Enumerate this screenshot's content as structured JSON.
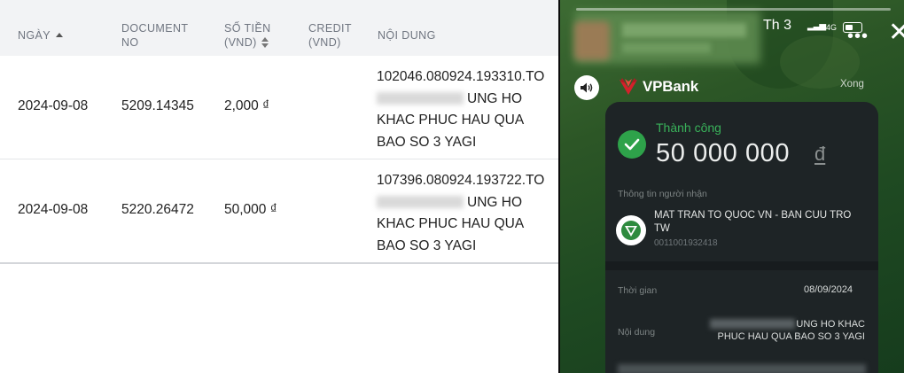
{
  "statement": {
    "headers": {
      "date": "NGÀY",
      "doc_line1": "DOCUMENT",
      "doc_line2": "NO",
      "amount_line1": "SỐ TIỀN",
      "amount_line2": "(VND)",
      "credit_line1": "CREDIT",
      "credit_line2": "(VND)",
      "content": "NỘI DUNG"
    },
    "rows": [
      {
        "date": "2024-09-08",
        "doc_no": "5209.14345",
        "amount": "2,000 ₫",
        "content_line1": "102046.080924.193310.TO",
        "content_line2": "UNG HO",
        "content_line3": "KHAC PHUC HAU QUA",
        "content_line4": "BAO SO 3 YAGI"
      },
      {
        "date": "2024-09-08",
        "doc_no": "5220.26472",
        "amount": "50,000 ₫",
        "content_line1": "107396.080924.193722.TO",
        "content_line2": "UNG HO",
        "content_line3": "KHAC PHUC HAU QUA",
        "content_line4": "BAO SO 3 YAGI"
      }
    ]
  },
  "phone": {
    "status_time": "Th 3",
    "network": "4G",
    "brand": "VPBank",
    "done_label": "Xong",
    "success_label": "Thành công",
    "amount": "50 000 000",
    "currency": "đ",
    "recipient_label": "Thông tin người nhận",
    "recipient_name": "MAT TRAN TO QUOC VN - BAN CUU TRO TW",
    "account_no": "0011001932418",
    "time_label": "Thời gian",
    "time_value": "08/09/2024",
    "content_label": "Nội dung",
    "content_value_line1": "UNG HO KHAC",
    "content_value_line2": "PHUC HAU QUA BAO SO 3 YAGI"
  },
  "colors": {
    "success_green": "#39b25a",
    "vpbank_red": "#d4212b",
    "header_bg": "#f2f3f5"
  }
}
